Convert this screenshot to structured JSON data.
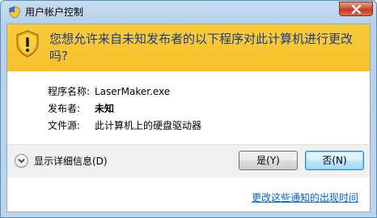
{
  "window": {
    "title": "用户帐户控制",
    "title_icon": "uac-shield-icon",
    "close_icon": "close-icon"
  },
  "banner": {
    "icon": "warning-shield-icon",
    "message": "您想允许来自未知发布者的以下程序对此计算机进行更改吗?",
    "background_color": "#f7c531",
    "text_color": "#1a3a8a"
  },
  "details": [
    {
      "label": "程序名称:",
      "value": "LaserMaker.exe",
      "bold": false
    },
    {
      "label": "发布者:",
      "value": "未知",
      "bold": true
    },
    {
      "label": "文件源:",
      "value": "此计算机上的硬盘驱动器",
      "bold": false
    }
  ],
  "footer": {
    "expand_label": "显示详细信息(D)",
    "yes_label": "是(Y)",
    "no_label": "否(N)",
    "link_label": "更改这些通知的出现时间"
  }
}
